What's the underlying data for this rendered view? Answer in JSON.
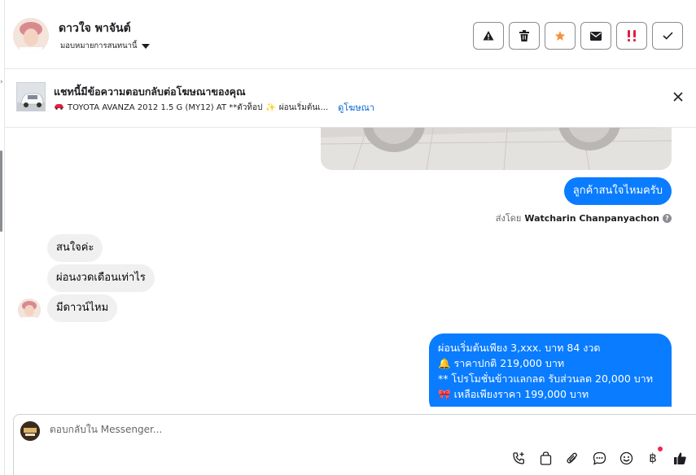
{
  "header": {
    "customer_name": "ดาวใจ พาจันต์",
    "assign_label": "มอบหมายการสนทนานี้",
    "actions": [
      "alert-icon",
      "trash-icon",
      "star-icon",
      "mail-icon",
      "spam-icon",
      "check-icon"
    ]
  },
  "ad": {
    "title": "แชทนี้มีข้อความตอบกลับต่อโฆษณาของคุณ",
    "subtitle": "TOYOTA AVANZA 2012 1.5 G (MY12) AT **ตัวท็อป",
    "subtitle_tail": "ผ่อนเริ่มต้นเ...",
    "link": "ดูโฆษณา"
  },
  "messages": {
    "out_question": "ลูกค้าสนใจไหมครับ",
    "sent_by_prefix": "ส่งโดย",
    "sent_by_name": "Watcharin Chanpanyachon",
    "in_1": "สนใจค่ะ",
    "in_2": "ผ่อนงวดเดือนเท่าไร",
    "in_3": "มีดาวน์ไหม",
    "reply_lines": [
      "ผ่อนเริ่มต้นเพียง 3,xxx. บาท 84 งวด",
      "ราคาปกติ 219,000 บาท",
      "** โปรโมชั่นข้าวแลกลด รับส่วนลด 20,000 บาท",
      "เหลือเพียงราคา 199,000 บาท"
    ]
  },
  "composer": {
    "placeholder": "ตอบกลับใน Messenger...",
    "tools": [
      "phone-plus-icon",
      "shopping-bag-icon",
      "paperclip-icon",
      "chat-bubble-icon",
      "smiley-icon",
      "baht-icon",
      "thumbs-up-icon"
    ],
    "baht_symbol": "฿"
  },
  "colors": {
    "accent": "#0a7cff",
    "star": "#f7923b",
    "spam": "#e41e3f"
  }
}
